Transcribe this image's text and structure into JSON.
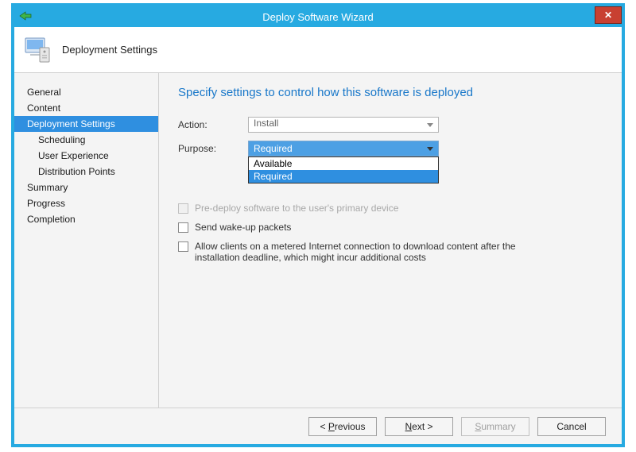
{
  "window": {
    "title": "Deploy Software Wizard",
    "close_symbol": "✕"
  },
  "header": {
    "page_title": "Deployment Settings"
  },
  "sidebar": {
    "items": [
      {
        "label": "General",
        "indent": 0,
        "selected": false
      },
      {
        "label": "Content",
        "indent": 0,
        "selected": false
      },
      {
        "label": "Deployment Settings",
        "indent": 0,
        "selected": true
      },
      {
        "label": "Scheduling",
        "indent": 1,
        "selected": false
      },
      {
        "label": "User Experience",
        "indent": 1,
        "selected": false
      },
      {
        "label": "Distribution Points",
        "indent": 1,
        "selected": false
      },
      {
        "label": "Summary",
        "indent": 0,
        "selected": false
      },
      {
        "label": "Progress",
        "indent": 0,
        "selected": false
      },
      {
        "label": "Completion",
        "indent": 0,
        "selected": false
      }
    ]
  },
  "main": {
    "heading": "Specify settings to control how this software is deployed",
    "action_label": "Action:",
    "action_value": "Install",
    "purpose_label": "Purpose:",
    "purpose_value": "Required",
    "purpose_options": [
      "Available",
      "Required"
    ],
    "purpose_highlight_index": 1,
    "predeploy_label": "Pre-deploy software to the user's primary device",
    "send_wakeup_label": "Send wake-up packets",
    "metered_label": "Allow clients on a metered Internet connection to download content after the installation deadline, which might incur additional costs"
  },
  "footer": {
    "previous": "< Previous",
    "next": "Next >",
    "summary": "Summary",
    "cancel": "Cancel"
  }
}
